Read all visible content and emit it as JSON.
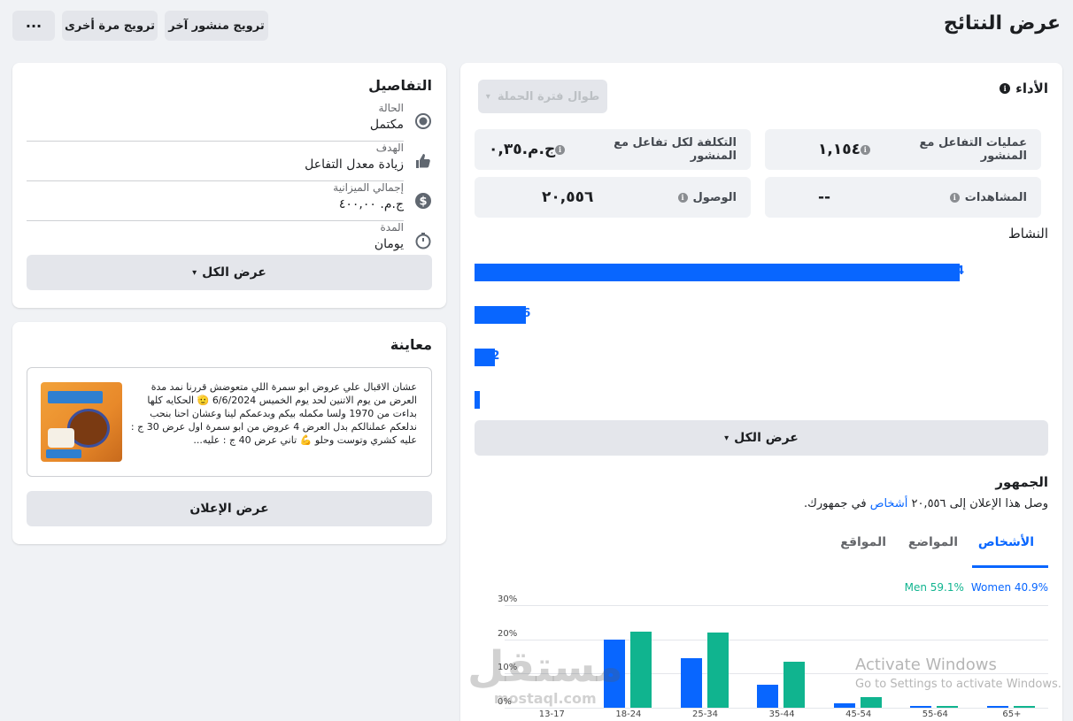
{
  "header": {
    "title": "عرض النتائج",
    "more_label": "···",
    "boost_again_label": "ترويج مرة أخرى",
    "boost_another_label": "ترويج منشور آخر"
  },
  "details": {
    "title": "التفاصيل",
    "rows": [
      {
        "label": "الحالة",
        "value": "مكتمل",
        "icon": "status-icon"
      },
      {
        "label": "الهدف",
        "value": "زيادة معدل التفاعل",
        "icon": "thumbs-up-icon"
      },
      {
        "label": "إجمالي الميزانية",
        "value": "ج.م. ٤٠٠,٠٠",
        "icon": "dollar-icon"
      },
      {
        "label": "المدة",
        "value": "يومان",
        "icon": "timer-icon"
      }
    ],
    "view_all_label": "عرض الكل"
  },
  "preview": {
    "title": "معاينة",
    "post_text": "عشان الاقبال علي عروض ابو سمرة اللي متعوضش قررنا نمد مدة العرض من يوم الاتنين لحد يوم الخميس 6/6/2024 🫡 الحكايه كلها بداءت من 1970 ولسا مكمله بيكم وبدعمكم لينا وعشان احنا بنحب ندلعكم عملنالكم بدل العرض 4 عروض من ابو سمرة اول عرض 30 ج : عليه كشري وتوست وحلو 💪 تاني عرض 40 ج : عليه...",
    "view_ad_label": "عرض الإعلان"
  },
  "performance": {
    "title": "الأداء",
    "dropdown_label": "طوال فترة الحملة",
    "metrics": {
      "engagements_label": "عمليات التفاعل مع المنشور",
      "engagements_value": "١,١٥٤",
      "cost_label": "التكلفة لكل تفاعل مع المنشور",
      "cost_value": "ج.م.٠,٣٥",
      "views_label": "المشاهدات",
      "views_value": "--",
      "reach_label": "الوصول",
      "reach_value": "٢٠,٥٥٦"
    },
    "activity_title": "النشاط",
    "activity_bars": [
      {
        "value": 1054,
        "label": "4"
      },
      {
        "value": 112,
        "label": "6"
      },
      {
        "value": 45,
        "label": "2"
      },
      {
        "value": 12,
        "label": ""
      }
    ],
    "view_all_label": "عرض الكل"
  },
  "audience": {
    "title": "الجمهور",
    "desc_prefix": "وصل هذا الإعلان إلى ",
    "desc_count": "٢٠,٥٥٦",
    "desc_link": "أشخاص",
    "desc_suffix": " في جمهورك.",
    "tabs": [
      "الأشخاص",
      "المواضع",
      "المواقع"
    ],
    "legend_women": "Women 40.9%",
    "legend_men": "Men 59.1%"
  },
  "chart_data": {
    "type": "bar",
    "categories": [
      "13-17",
      "18-24",
      "25-34",
      "35-44",
      "45-54",
      "55-64",
      "65+"
    ],
    "series": [
      {
        "name": "Women",
        "values": [
          0,
          20,
          14.5,
          6.8,
          1.3,
          0.4,
          0.4
        ],
        "color": "#0866ff"
      },
      {
        "name": "Men",
        "values": [
          0,
          22.3,
          22,
          13.5,
          3.2,
          0.6,
          0.4
        ],
        "color": "#10b48f"
      }
    ],
    "yticks": [
      "30%",
      "20%",
      "10%",
      "0%"
    ],
    "ylim": [
      0,
      30
    ]
  },
  "watermark": {
    "line1": "Activate Windows",
    "line2": "Go to Settings to activate Windows.",
    "brand": "مستقل",
    "brand_url": "mostaql.com"
  }
}
